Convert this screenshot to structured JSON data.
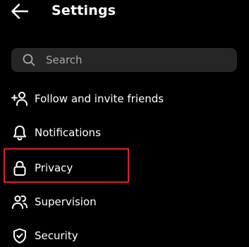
{
  "header": {
    "title": "Settings"
  },
  "search": {
    "placeholder": "Search"
  },
  "menu": {
    "items": [
      {
        "label": "Follow and invite friends",
        "icon": "add-person-icon"
      },
      {
        "label": "Notifications",
        "icon": "bell-icon"
      },
      {
        "label": "Privacy",
        "icon": "lock-icon"
      },
      {
        "label": "Supervision",
        "icon": "people-icon"
      },
      {
        "label": "Security",
        "icon": "shield-check-icon"
      }
    ]
  },
  "highlight": {
    "target": "Privacy",
    "color": "#e01e24"
  },
  "colors": {
    "background": "#000000",
    "search_field": "#262626",
    "placeholder_text": "#a8a8a8",
    "text": "#ffffff"
  }
}
